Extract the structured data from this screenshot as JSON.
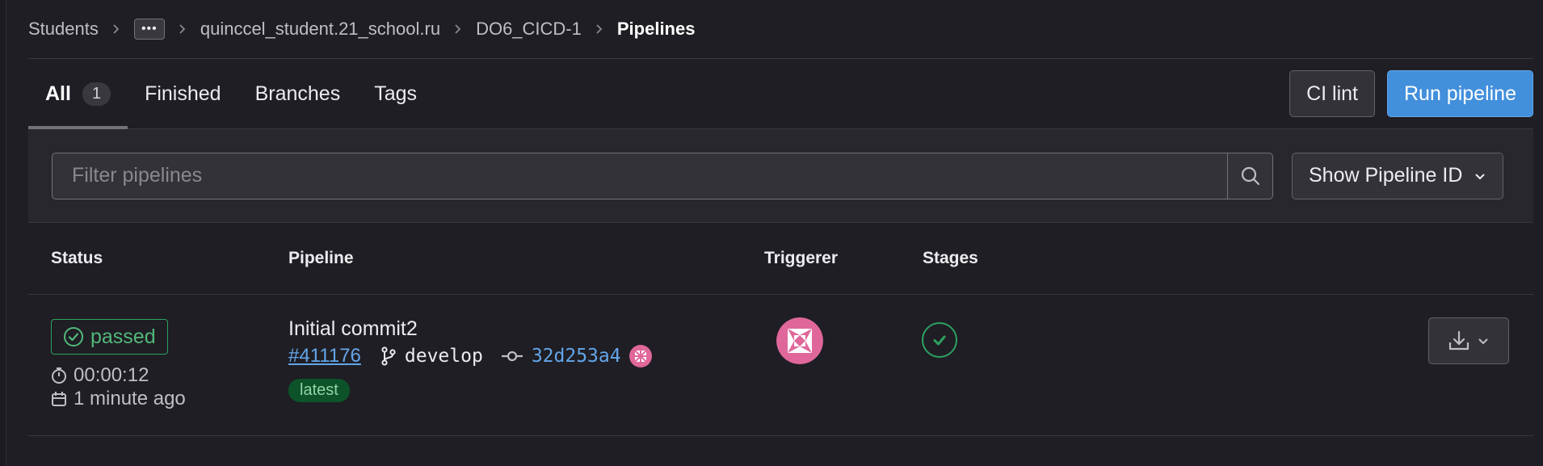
{
  "breadcrumb": {
    "items": [
      "Students",
      "quinccel_student.21_school.ru",
      "DO6_CICD-1",
      "Pipelines"
    ],
    "more_label": "•••"
  },
  "tabs": [
    {
      "label": "All",
      "count": "1",
      "active": true
    },
    {
      "label": "Finished"
    },
    {
      "label": "Branches"
    },
    {
      "label": "Tags"
    }
  ],
  "actions": {
    "ci_lint_label": "CI lint",
    "run_pipeline_label": "Run pipeline"
  },
  "filter": {
    "placeholder": "Filter pipelines",
    "select_label": "Show Pipeline ID"
  },
  "table": {
    "columns": [
      "Status",
      "Pipeline",
      "Triggerer",
      "Stages"
    ],
    "rows": [
      {
        "status": "passed",
        "duration": "00:00:12",
        "finished": "1 minute ago",
        "title": "Initial commit2",
        "pipeline_id": "#411176",
        "branch": "develop",
        "sha": "32d253a4",
        "badge": "latest"
      }
    ]
  },
  "colors": {
    "success": "#2da160",
    "primary": "#428fdc",
    "link": "#63a6e9",
    "avatar": "#e0679a"
  },
  "icons": [
    "chevron-right-icon",
    "search-icon",
    "chevron-down-icon",
    "check-circle-icon",
    "timer-icon",
    "calendar-icon",
    "branch-icon",
    "commit-icon",
    "download-icon",
    "status-success-icon"
  ]
}
